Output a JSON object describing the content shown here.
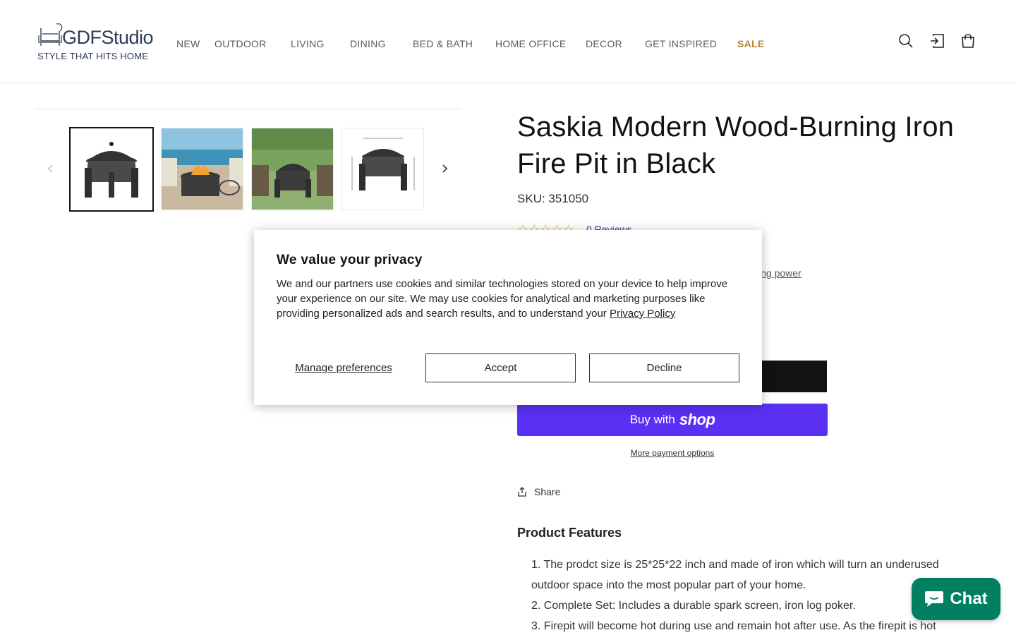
{
  "header": {
    "logo": {
      "brand": "GDFStudio",
      "tagline": "STYLE THAT HITS HOME"
    },
    "nav": [
      "NEW",
      "OUTDOOR",
      "LIVING",
      "DINING",
      "BED & BATH",
      "HOME OFFICE",
      "DECOR",
      "GET INSPIRED",
      "SALE"
    ],
    "icons": [
      "search-icon",
      "account-icon",
      "cart-icon"
    ]
  },
  "product": {
    "title": "Saskia Modern Wood-Burning Iron Fire Pit in Black",
    "sku": "SKU: 351050",
    "rating_stars": "☆☆☆☆☆",
    "reviews": "0 Reviews",
    "partial_text": "sing power",
    "shop_pre": "Buy with",
    "shop_word": "shop",
    "more_payment": "More payment options",
    "share": "Share",
    "features_title": "Product Features",
    "features": [
      "1. The prodct size is 25*25*22 inch and made of iron which will turn an underused outdoor space into the most popular part of your home.",
      "2. Complete Set: Includes a durable spark screen, iron log poker.",
      "3. Firepit will become hot during use and remain hot after use. As the firepit is hot"
    ]
  },
  "cookie": {
    "title": "We value your privacy",
    "body": "We and our partners use cookies and similar technologies stored on your device to help improve your experience on our site. We may use cookies for analytical and marketing purposes like providing personalized ads and search results, and to understand your ",
    "policy_link": "Privacy Policy",
    "manage": "Manage preferences",
    "accept": "Accept",
    "decline": "Decline"
  },
  "chat": {
    "label": "Chat"
  },
  "colors": {
    "accent": "#5a31f4",
    "sale": "#b8862e",
    "chat": "#008060",
    "stars": "#d4a24a"
  }
}
